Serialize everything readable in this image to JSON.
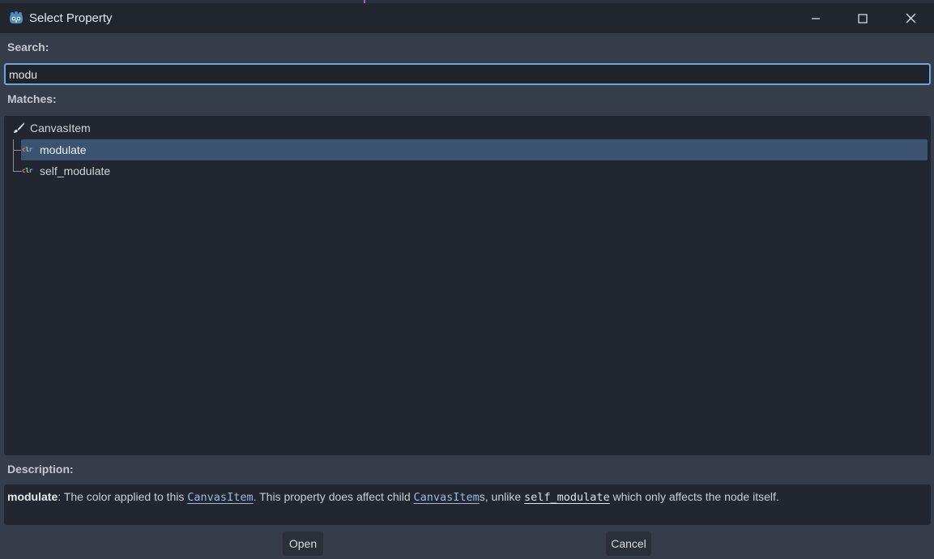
{
  "window": {
    "title": "Select Property",
    "icon": "godot-icon",
    "controls": [
      "minimize-icon",
      "maximize-icon",
      "close-icon"
    ]
  },
  "search": {
    "label": "Search:",
    "value": "modu"
  },
  "matches": {
    "label": "Matches:",
    "tree": {
      "root": {
        "label": "CanvasItem",
        "icon": "brush-icon"
      },
      "items": [
        {
          "label": "modulate",
          "icon": "clr",
          "selected": true
        },
        {
          "label": "self_modulate",
          "icon": "clr",
          "selected": false
        }
      ]
    }
  },
  "description": {
    "label": "Description:",
    "term": "modulate",
    "part1": ": The color applied to this ",
    "ref1": "CanvasItem",
    "part2": ". This property does affect child ",
    "ref2": "CanvasItem",
    "ref2_suffix": "s, unlike ",
    "ref3": "self_modulate",
    "part3": " which only affects the node itself."
  },
  "buttons": {
    "open": "Open",
    "cancel": "Cancel"
  },
  "colors": {
    "accent": "#6ea3dd",
    "selection": "#3c5370",
    "background": "#363d4a",
    "panel": "#212630"
  }
}
